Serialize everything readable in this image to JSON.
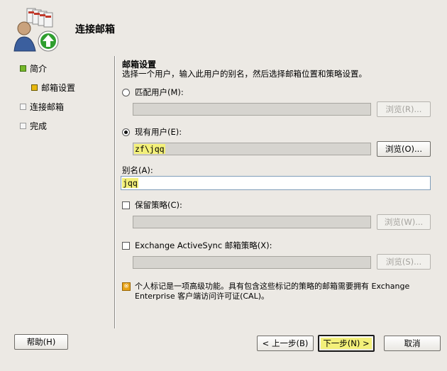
{
  "title": "连接邮箱",
  "sidebar": {
    "items": [
      {
        "label": "简介",
        "state": "green"
      },
      {
        "label": "邮箱设置",
        "state": "yellow"
      },
      {
        "label": "连接邮箱",
        "state": "empty"
      },
      {
        "label": "完成",
        "state": "empty"
      }
    ]
  },
  "section": {
    "title": "邮箱设置",
    "description": "选择一个用户，输入此用户的别名，然后选择邮箱位置和策略设置。"
  },
  "options": {
    "matching_user": {
      "label": "匹配用户(M):",
      "value": "",
      "browse_label": "浏览(R)..."
    },
    "existing_user": {
      "label": "现有用户(E):",
      "value": "zf\\jqq",
      "browse_label": "浏览(O)..."
    }
  },
  "alias": {
    "label": "别名(A):",
    "value": "jqq"
  },
  "retention": {
    "label": "保留策略(C):",
    "value": "",
    "browse_label": "浏览(W)..."
  },
  "activesync": {
    "label": "Exchange ActiveSync 邮箱策略(X):",
    "value": "",
    "browse_label": "浏览(S)..."
  },
  "note": "个人标记是一项高级功能。具有包含这些标记的策略的邮箱需要拥有 Exchange Enterprise 客户端访问许可证(CAL)。",
  "footer": {
    "help": "帮助(H)",
    "back": "< 上一步(B)",
    "next": "下一步(N) >",
    "cancel": "取消"
  },
  "colors": {
    "highlight": "#f3f07a",
    "background": "#ece9e4"
  }
}
